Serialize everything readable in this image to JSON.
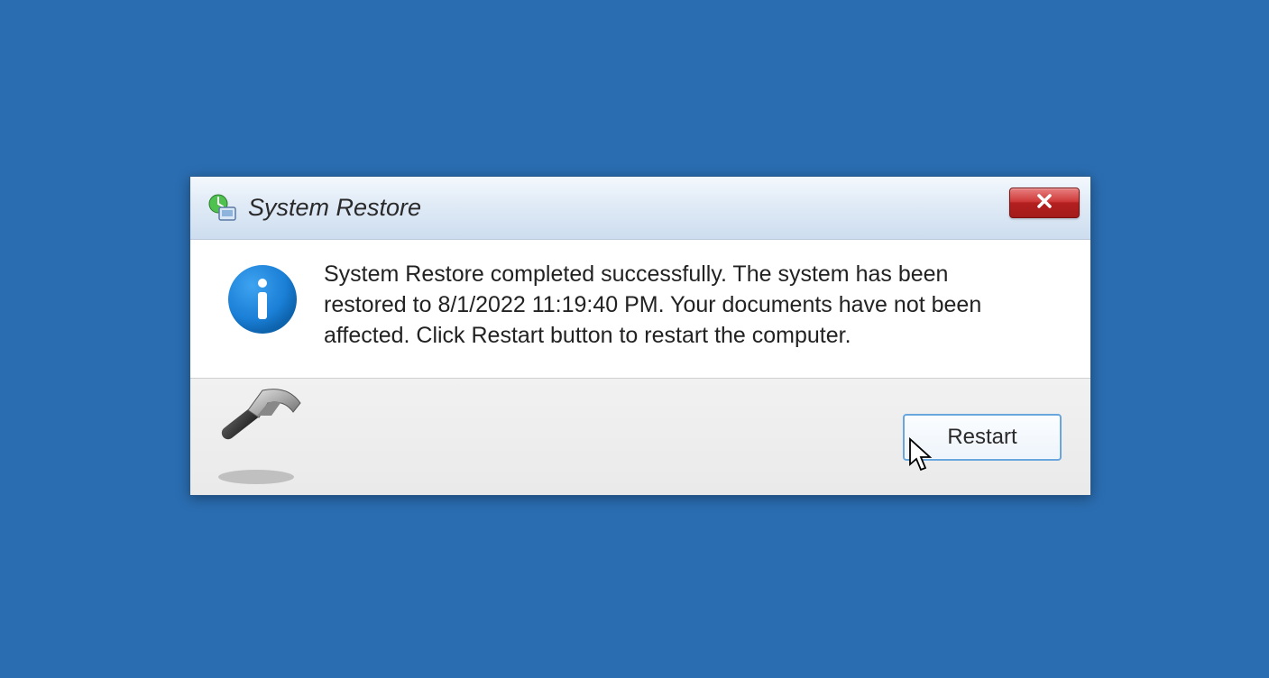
{
  "dialog": {
    "title": "System Restore",
    "message": "System Restore completed successfully. The system has been restored to 8/1/2022 11:19:40 PM. Your documents have not been affected. Click Restart button to restart the computer.",
    "restart_label": "Restart"
  },
  "colors": {
    "desktop_bg": "#2a6db1",
    "close_red": "#c33636",
    "info_blue": "#1a7fd6"
  }
}
